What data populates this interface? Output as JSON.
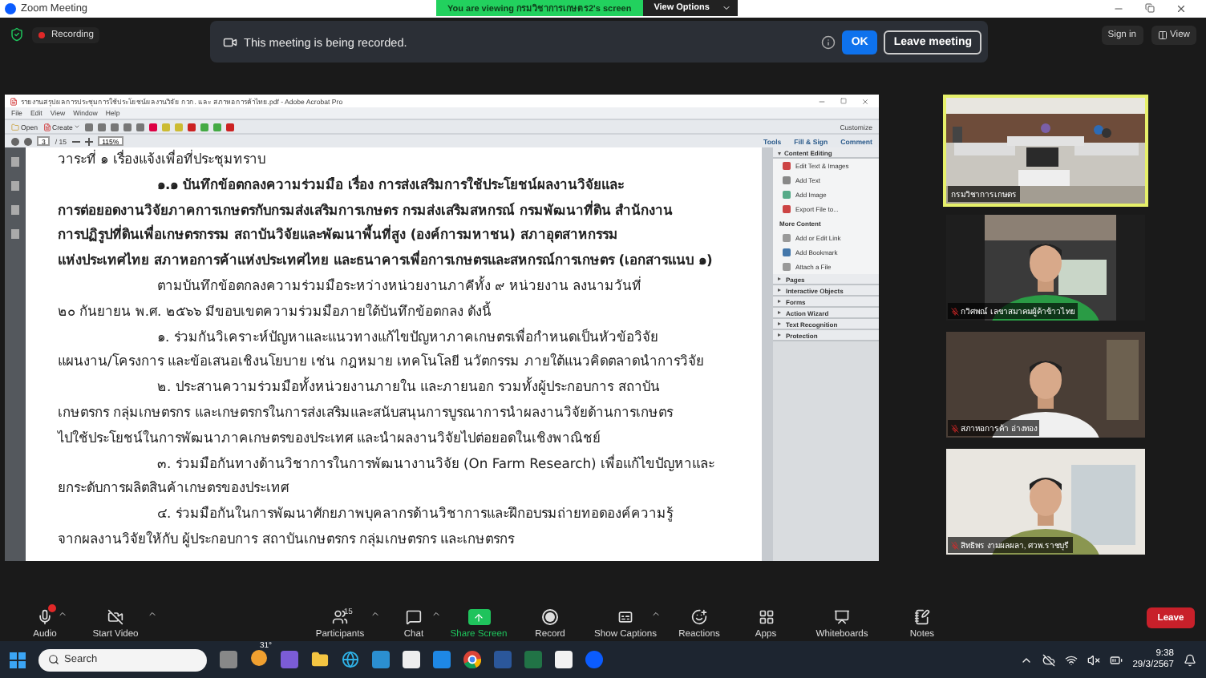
{
  "window": {
    "title": "Zoom Meeting"
  },
  "viewing_banner": {
    "text": "You are viewing กรมวิชาการเกษตร2's screen",
    "button": "View Options"
  },
  "recording": {
    "label": "Recording"
  },
  "notice": {
    "text": "This meeting is being recorded.",
    "ok": "OK",
    "leave": "Leave meeting"
  },
  "top_buttons": [
    {
      "label": "Sign in",
      "kind": "text"
    },
    {
      "label": "View",
      "kind": "view"
    }
  ],
  "acrobat": {
    "title": "รายงานสรุปผลการประชุมการใช้ประโยชน์ผลงานวิจัย กวก. และ สภาหอการค้าไทย.pdf - Adobe Acrobat Pro",
    "menu": [
      "File",
      "Edit",
      "View",
      "Window",
      "Help"
    ],
    "open": "Open",
    "create": "Create",
    "customize": "Customize",
    "page": "3",
    "page_total": "/ 15",
    "zoom": "115%",
    "panel_tabs": [
      "Tools",
      "Fill & Sign",
      "Comment"
    ],
    "lines": [
      {
        "text": "วาระที่ ๑ เรื่องแจ้งเพื่อที่ประชุมทราบ",
        "kind": "plain",
        "bold": false
      },
      {
        "text": "๑.๑ บันทึกข้อตกลงความร่วมมือ เรื่อง การส่งเสริมการใช้ประโยชน์ผลงานวิจัยและ",
        "kind": "indent",
        "bold": true
      },
      {
        "text": "การต่อยอดงานวิจัยภาคการเกษตรกับกรมส่งเสริมการเกษตร กรมส่งเสริมสหกรณ์ กรมพัฒนาที่ดิน สำนักงาน",
        "kind": "plain",
        "bold": true
      },
      {
        "text": "การปฏิรูปที่ดินเพื่อเกษตรกรรม สถาบันวิจัยและพัฒนาพื้นที่สูง (องค์การมหาชน) สภาอุตสาหกรรม",
        "kind": "plain",
        "bold": true
      },
      {
        "text": "แห่งประเทศไทย สภาหอการค้าแห่งประเทศไทย และธนาคารเพื่อการเกษตรและสหกรณ์การเกษตร (เอกสารแนบ ๑)",
        "kind": "plain",
        "bold": true
      },
      {
        "text": "ตามบันทึกข้อตกลงความร่วมมือระหว่างหน่วยงานภาคีทั้ง ๙ หน่วยงาน ลงนามวันที่",
        "kind": "indent",
        "bold": false
      },
      {
        "text": "๒๐ กันยายน พ.ศ. ๒๕๖๖ มีขอบเขตความร่วมมือภายใต้บันทึกข้อตกลง ดังนี้",
        "kind": "plain",
        "bold": false
      },
      {
        "text": "๑. ร่วมกันวิเคราะห์ปัญหาและแนวทางแก้ไขปัญหาภาคเกษตรเพื่อกำหนดเป็นหัวข้อวิจัย",
        "kind": "indent",
        "bold": false
      },
      {
        "text": "แผนงาน/โครงการ และข้อเสนอเชิงนโยบาย เช่น กฎหมาย เทคโนโลยี นวัตกรรม ภายใต้แนวคิดตลาดนำการวิจัย",
        "kind": "plain",
        "bold": false
      },
      {
        "text": "๒. ประสานความร่วมมือทั้งหน่วยงานภายใน และภายนอก รวมทั้งผู้ประกอบการ สถาบัน",
        "kind": "indent",
        "bold": false
      },
      {
        "text": "เกษตรกร กลุ่มเกษตรกร และเกษตรกรในการส่งเสริมและสนับสนุนการบูรณาการนำผลงานวิจัยด้านการเกษตร",
        "kind": "plain",
        "bold": false
      },
      {
        "text": "ไปใช้ประโยชน์ในการพัฒนาภาคเกษตรของประเทศ และนำผลงานวิจัยไปต่อยอดในเชิงพาณิชย์",
        "kind": "plain",
        "bold": false
      },
      {
        "text": "๓. ร่วมมือกันทางด้านวิชาการในการพัฒนางานวิจัย (On Farm Research) เพื่อแก้ไขปัญหาและ",
        "kind": "indent",
        "bold": false
      },
      {
        "text": "ยกระดับการผลิตสินค้าเกษตรของประเทศ",
        "kind": "plain",
        "bold": false
      },
      {
        "text": "๔. ร่วมมือกันในการพัฒนาศักยภาพบุคลากรด้านวิชาการและฝึกอบรมถ่ายทอดองค์ความรู้",
        "kind": "indent",
        "bold": false
      },
      {
        "text": "จากผลงานวิจัยให้กับ ผู้ประกอบการ สถาบันเกษตรกร กลุ่มเกษตรกร และเกษตรกร",
        "kind": "plain",
        "bold": false
      }
    ],
    "sections": [
      {
        "label": "Content Editing",
        "expanded": true,
        "items": [
          {
            "label": "Edit Text & Images",
            "kind": "edit"
          },
          {
            "label": "Add Text",
            "kind": "text"
          },
          {
            "label": "Add Image"
          },
          {
            "label": "Export File to...",
            "kind": "export"
          }
        ],
        "sub_label": "More Content",
        "sub_items": [
          {
            "label": "Add or Edit Link",
            "kind": "link"
          },
          {
            "label": "Add Bookmark",
            "kind": "bookmark"
          },
          {
            "label": "Attach a File",
            "kind": "attach"
          }
        ]
      },
      {
        "label": "Pages",
        "expanded": false
      },
      {
        "label": "Interactive Objects",
        "expanded": false
      },
      {
        "label": "Forms",
        "expanded": false
      },
      {
        "label": "Action Wizard",
        "expanded": false
      },
      {
        "label": "Text Recognition",
        "expanded": false
      },
      {
        "label": "Protection",
        "expanded": false
      }
    ]
  },
  "videos": [
    {
      "name": "กรมวิชาการเกษตร",
      "active": true,
      "muted": false
    },
    {
      "name": "กวิศพณ์ เลขาสมาคมผู้ค้าข้าวไทย",
      "active": false,
      "muted": true
    },
    {
      "name": "สภาหอการค้า อ่างทอง",
      "active": false,
      "muted": true
    },
    {
      "name": "สิทธิพร งามผลผลา, ศวพ.ราชบุรี",
      "active": false,
      "muted": true
    }
  ],
  "toolbar": [
    {
      "label": "Audio",
      "kind": "audio",
      "caret": true
    },
    {
      "label": "Start Video",
      "kind": "video",
      "caret": true
    },
    {
      "label": "Participants",
      "kind": "participants",
      "caret": true,
      "count": "15"
    },
    {
      "label": "Chat",
      "kind": "chat",
      "caret": true
    },
    {
      "label": "Share Screen",
      "kind": "share",
      "caret": false
    },
    {
      "label": "Record",
      "kind": "record",
      "caret": false
    },
    {
      "label": "Show Captions",
      "kind": "captions",
      "caret": true
    },
    {
      "label": "Reactions",
      "kind": "reactions",
      "caret": false
    },
    {
      "label": "Apps",
      "kind": "apps",
      "caret": false
    },
    {
      "label": "Whiteboards",
      "kind": "whiteboards",
      "caret": false
    },
    {
      "label": "Notes",
      "kind": "notes",
      "caret": false
    }
  ],
  "leave": "Leave",
  "taskbar": {
    "search": {
      "placeholder": "Search"
    },
    "weather": "31°",
    "time": "9:38",
    "date": "29/3/2567"
  }
}
